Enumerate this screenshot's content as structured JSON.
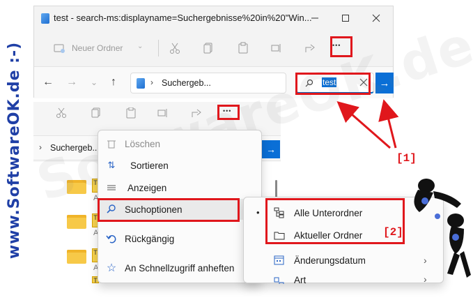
{
  "watermark": {
    "side": "www.SoftwareOK.de :-)",
    "big": "SoftwareOK.de"
  },
  "window": {
    "title": "test - search-ms:displayname=Suchergebnisse%20in%20\"Win...",
    "new_folder_label": "Neuer Ordner",
    "more_glyph": "•••"
  },
  "address": {
    "breadcrumb": "Suchergeb...",
    "search_value": "test"
  },
  "window2": {
    "breadcrumb": "Suchergeb...",
    "more_glyph": "•••",
    "folder_tags": [
      "T",
      "T",
      "T",
      "T"
    ],
    "folder_sub": [
      "A",
      "A",
      "A"
    ]
  },
  "menu": {
    "items": [
      {
        "label": "Löschen",
        "icon": "trash-icon"
      },
      {
        "label": "Sortieren",
        "icon": "sort-icon"
      },
      {
        "label": "Anzeigen",
        "icon": "view-icon"
      },
      {
        "label": "Suchoptionen",
        "icon": "search-options-icon"
      },
      {
        "label": "Rückgängig",
        "icon": "undo-icon"
      },
      {
        "label": "An Schnellzugriff anheften",
        "icon": "star-icon"
      }
    ]
  },
  "submenu": {
    "items": [
      {
        "label": "Alle Unterordner",
        "icon": "subfolders-icon",
        "selected": true
      },
      {
        "label": "Aktueller Ordner",
        "icon": "folder-icon",
        "selected": false
      },
      {
        "label": "Änderungsdatum",
        "icon": "calendar-icon"
      },
      {
        "label": "Art",
        "icon": "type-icon"
      }
    ]
  },
  "annotations": {
    "label1": "[1]",
    "label2": "[2]"
  },
  "colors": {
    "accent": "#0a6fd6",
    "highlight": "#e0171c",
    "folder": "#f7c948",
    "watermark_blue": "#1f3fa6"
  }
}
